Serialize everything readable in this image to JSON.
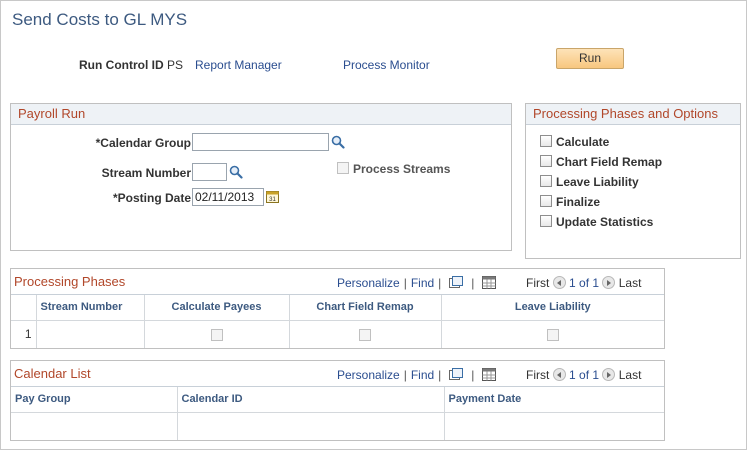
{
  "page": {
    "title": "Send Costs to GL MYS",
    "run_control_label": "Run Control ID",
    "run_control_value": "PS",
    "report_manager_label": "Report Manager",
    "process_monitor_label": "Process Monitor",
    "run_label": "Run"
  },
  "payroll_run": {
    "header": "Payroll Run",
    "calendar_group_label": "*Calendar Group",
    "calendar_group_value": "",
    "stream_number_label": "Stream Number",
    "stream_number_value": "",
    "posting_date_label": "*Posting Date",
    "posting_date_value": "02/11/2013",
    "process_streams_label": "Process Streams",
    "process_streams_checked": false,
    "calendar_icon_text": "31"
  },
  "phases_options": {
    "header": "Processing Phases and Options",
    "items": [
      {
        "label": "Calculate",
        "checked": false
      },
      {
        "label": "Chart Field Remap",
        "checked": false
      },
      {
        "label": "Leave Liability",
        "checked": false
      },
      {
        "label": "Finalize",
        "checked": false
      },
      {
        "label": "Update Statistics",
        "checked": false
      }
    ]
  },
  "processing_phases_grid": {
    "title": "Processing Phases",
    "personalize_label": "Personalize",
    "find_label": "Find",
    "first_label": "First",
    "page_status": "1 of 1",
    "last_label": "Last",
    "columns": [
      "Stream Number",
      "Calculate Payees",
      "Chart Field Remap",
      "Leave Liability"
    ],
    "rows": [
      {
        "index": "1",
        "stream_number": "",
        "calculate_payees": false,
        "chart_field_remap": false,
        "leave_liability": false
      }
    ]
  },
  "calendar_list_grid": {
    "title": "Calendar List",
    "personalize_label": "Personalize",
    "find_label": "Find",
    "first_label": "First",
    "page_status": "1 of 1",
    "last_label": "Last",
    "columns": [
      "Pay Group",
      "Calendar ID",
      "Payment Date"
    ]
  },
  "colors": {
    "title": "#3d5a80",
    "section_header": "#b1472a",
    "link": "#2a4d8f",
    "run_button": "#f8c77f"
  }
}
